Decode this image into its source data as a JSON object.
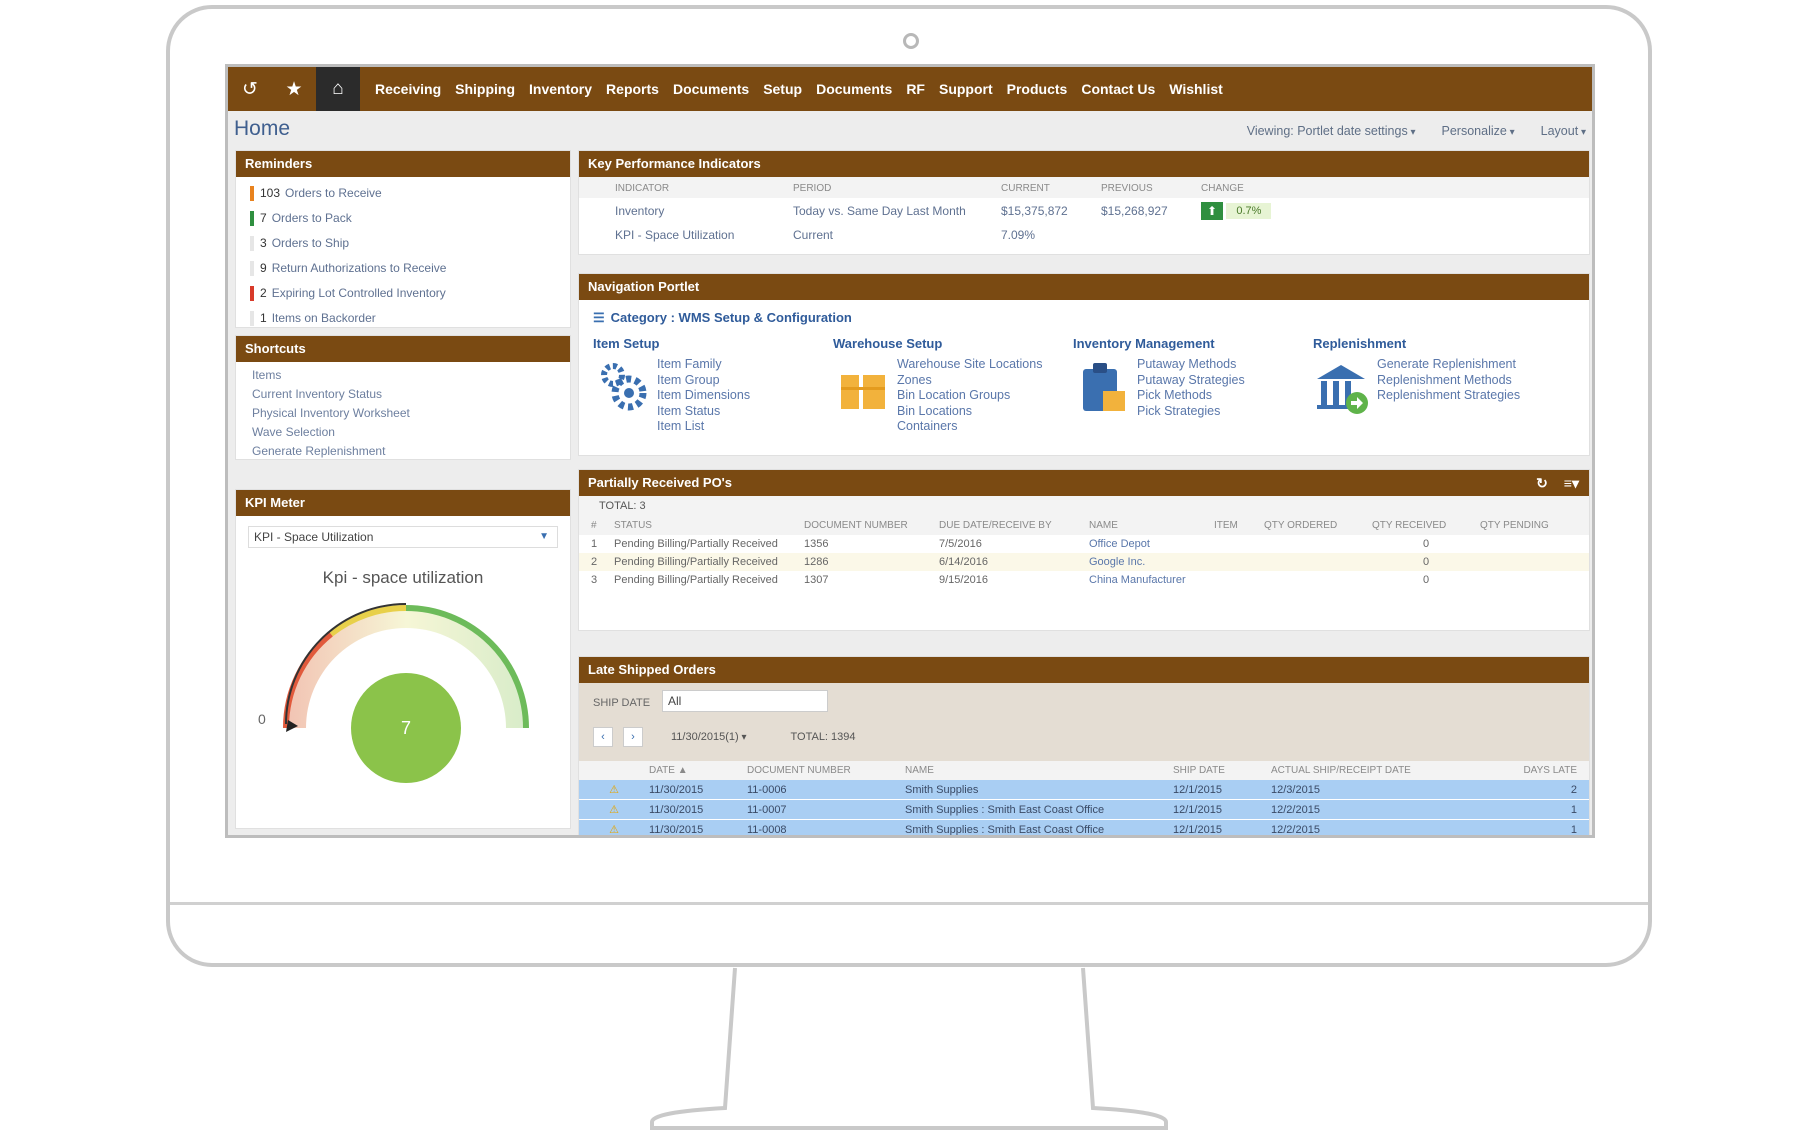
{
  "nav": {
    "icons": [
      "history-icon",
      "star-icon",
      "home-icon"
    ],
    "items": [
      "Receiving",
      "Shipping",
      "Inventory",
      "Reports",
      "Documents",
      "Setup",
      "Documents",
      "RF",
      "Support",
      "Products",
      "Contact Us",
      "Wishlist"
    ]
  },
  "page": {
    "title": "Home",
    "viewing": "Viewing: Portlet date settings",
    "personalize": "Personalize",
    "layout": "Layout"
  },
  "reminders": {
    "title": "Reminders",
    "items": [
      {
        "count": "103",
        "label": "Orders to Receive",
        "color": "#e8821e"
      },
      {
        "count": "7",
        "label": "Orders to Pack",
        "color": "#2f8f3f"
      },
      {
        "count": "3",
        "label": "Orders to Ship",
        "color": ""
      },
      {
        "count": "9",
        "label": "Return Authorizations to Receive",
        "color": ""
      },
      {
        "count": "2",
        "label": "Expiring Lot Controlled Inventory",
        "color": "#d83a2a"
      },
      {
        "count": "1",
        "label": "Items on Backorder",
        "color": ""
      }
    ]
  },
  "shortcuts": {
    "title": "Shortcuts",
    "items": [
      "Items",
      "Current Inventory Status",
      "Physical Inventory Worksheet",
      "Wave Selection",
      "Generate Replenishment"
    ]
  },
  "kpi_meter": {
    "title": "KPI Meter",
    "selected": "KPI - Space Utilization",
    "gauge_title": "Kpi - space utilization",
    "min_label": "0",
    "value": "7"
  },
  "kpi": {
    "title": "Key Performance Indicators",
    "headers": [
      "INDICATOR",
      "PERIOD",
      "CURRENT",
      "PREVIOUS",
      "CHANGE"
    ],
    "rows": [
      {
        "indicator": "Inventory",
        "period": "Today vs. Same Day Last Month",
        "current": "$15,375,872",
        "previous": "$15,268,927",
        "change": "0.7%"
      },
      {
        "indicator": "KPI - Space Utilization",
        "period": "Current",
        "current": "7.09%",
        "previous": "",
        "change": ""
      }
    ]
  },
  "navportlet": {
    "title": "Navigation Portlet",
    "category": "Category : WMS Setup & Configuration",
    "columns": [
      {
        "heading": "Item Setup",
        "links": [
          "Item Family",
          "Item Group",
          "Item Dimensions",
          "Item Status",
          "Item List"
        ]
      },
      {
        "heading": "Warehouse Setup",
        "links": [
          "Warehouse Site Locations",
          "Zones",
          "Bin Location Groups",
          "Bin Locations",
          "Containers"
        ]
      },
      {
        "heading": "Inventory Management",
        "links": [
          "Putaway Methods",
          "Putaway Strategies",
          "Pick Methods",
          "Pick Strategies"
        ]
      },
      {
        "heading": "Replenishment",
        "links": [
          "Generate Replenishment",
          "Replenishment Methods",
          "Replenishment Strategies"
        ]
      }
    ]
  },
  "po": {
    "title": "Partially Received PO's",
    "total": "TOTAL: 3",
    "headers": [
      "#",
      "STATUS",
      "DOCUMENT NUMBER",
      "DUE DATE/RECEIVE BY",
      "NAME",
      "ITEM",
      "QTY ORDERED",
      "QTY RECEIVED",
      "QTY PENDING"
    ],
    "rows": [
      {
        "n": "1",
        "status": "Pending Billing/Partially Received",
        "doc": "1356",
        "due": "7/5/2016",
        "name": "Office Depot",
        "item": "",
        "ordered": "",
        "received": "0",
        "pending": ""
      },
      {
        "n": "2",
        "status": "Pending Billing/Partially Received",
        "doc": "1286",
        "due": "6/14/2016",
        "name": "Google Inc.",
        "item": "",
        "ordered": "",
        "received": "0",
        "pending": ""
      },
      {
        "n": "3",
        "status": "Pending Billing/Partially Received",
        "doc": "1307",
        "due": "9/15/2016",
        "name": "China Manufacturer",
        "item": "",
        "ordered": "",
        "received": "0",
        "pending": ""
      }
    ]
  },
  "late": {
    "title": "Late Shipped Orders",
    "ship_date_label": "SHIP DATE",
    "ship_date_value": "All",
    "range": "11/30/2015(1)",
    "total": "TOTAL: 1394",
    "headers": [
      "",
      "DATE ▲",
      "DOCUMENT NUMBER",
      "NAME",
      "SHIP DATE",
      "ACTUAL SHIP/RECEIPT DATE",
      "DAYS LATE"
    ],
    "rows": [
      {
        "date": "11/30/2015",
        "doc": "11-0006",
        "name": "Smith Supplies",
        "ship": "12/1/2015",
        "actual": "12/3/2015",
        "days": "2"
      },
      {
        "date": "11/30/2015",
        "doc": "11-0007",
        "name": "Smith Supplies : Smith East Coast Office",
        "ship": "12/1/2015",
        "actual": "12/2/2015",
        "days": "1"
      },
      {
        "date": "11/30/2015",
        "doc": "11-0008",
        "name": "Smith Supplies : Smith East Coast Office",
        "ship": "12/1/2015",
        "actual": "12/2/2015",
        "days": "1"
      }
    ]
  }
}
